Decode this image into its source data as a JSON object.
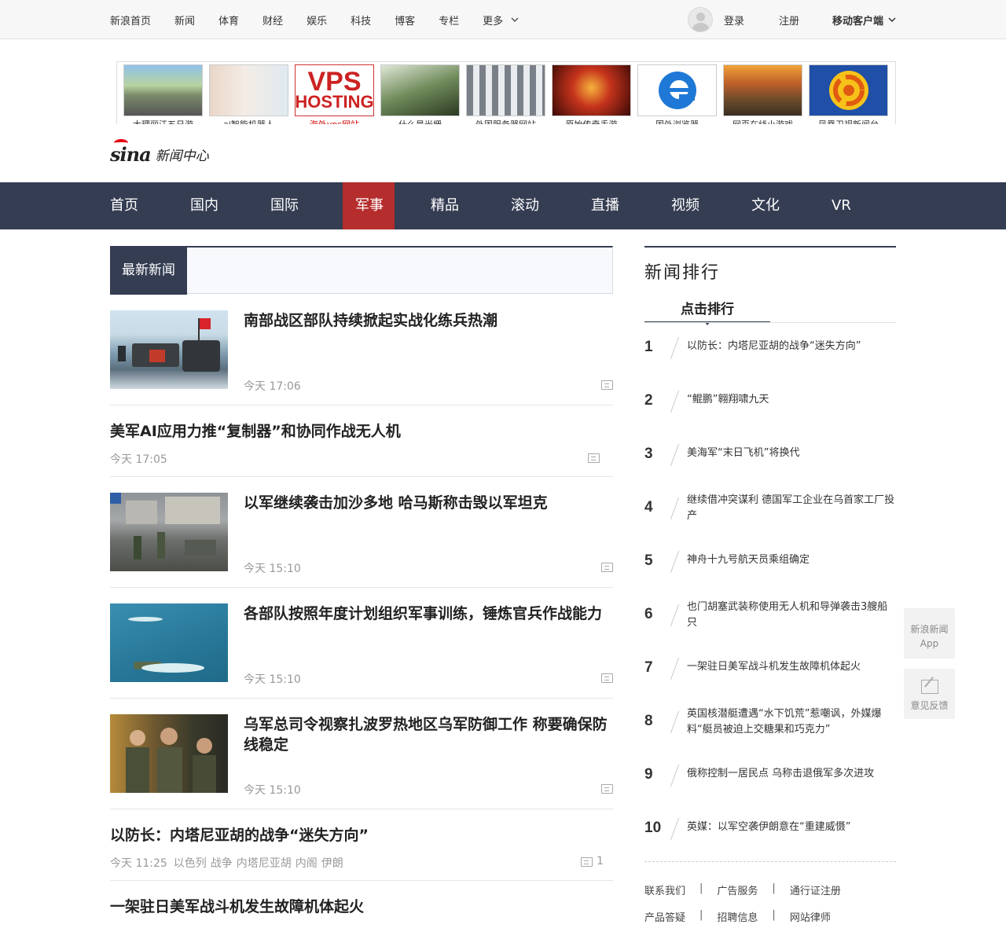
{
  "topbar": {
    "nav": [
      "新浪首页",
      "新闻",
      "体育",
      "财经",
      "娱乐",
      "科技",
      "博客",
      "专栏",
      "更多"
    ],
    "login": "登录",
    "register": "注册",
    "mobile_client": "移动客户端"
  },
  "ads": [
    {
      "caption": "大理丽江五日游",
      "red": false
    },
    {
      "caption": "ai智能机器人",
      "red": false
    },
    {
      "caption": "海外vps网站",
      "red": true
    },
    {
      "caption": "什么是光栅",
      "red": false
    },
    {
      "caption": "外国服务器网站",
      "red": false
    },
    {
      "caption": "原始传奇手游",
      "red": false
    },
    {
      "caption": "国外浏览器",
      "red": false
    },
    {
      "caption": "网页在线小游戏",
      "red": false
    },
    {
      "caption": "凤凰卫视新闻台",
      "red": false
    }
  ],
  "logo": {
    "brand": "sina",
    "section": "新闻中心"
  },
  "mainnav": [
    "首页",
    "国内",
    "国际",
    "军事",
    "精品",
    "滚动",
    "直播",
    "视频",
    "文化",
    "VR"
  ],
  "mainnav_active": "军事",
  "latest_label": "最新新闻",
  "news": [
    {
      "title": "南部战区部队持续掀起实战化练兵热潮",
      "time": "今天 17:06",
      "has_thumb": true
    },
    {
      "title": "美军AI应用力推“复制器”和协同作战无人机",
      "time": "今天 17:05",
      "has_thumb": false
    },
    {
      "title": "以军继续袭击加沙多地 哈马斯称击毁以军坦克",
      "time": "今天 15:10",
      "has_thumb": true
    },
    {
      "title": "各部队按照年度计划组织军事训练，锤炼官兵作战能力",
      "time": "今天 15:10",
      "has_thumb": true
    },
    {
      "title": "乌军总司令视察扎波罗热地区乌军防御工作 称要确保防线稳定",
      "time": "今天 15:10",
      "has_thumb": true
    },
    {
      "title": "以防长：内塔尼亚胡的战争“迷失方向”",
      "time": "今天 11:25",
      "tags": [
        "以色列",
        "战争",
        "内塔尼亚胡",
        "内阁",
        "伊朗"
      ],
      "comments": "1",
      "has_thumb": false
    },
    {
      "title": "一架驻日美军战斗机发生故障机体起火",
      "time": "",
      "has_thumb": false
    }
  ],
  "ranking": {
    "title": "新闻排行",
    "tab": "点击排行",
    "items": [
      {
        "num": "1",
        "text": "以防长：内塔尼亚胡的战争“迷失方向”"
      },
      {
        "num": "2",
        "text": "“鲲鹏”翱翔啸九天"
      },
      {
        "num": "3",
        "text": "美海军“末日飞机”将换代"
      },
      {
        "num": "4",
        "text": "继续借冲突谋利 德国军工企业在乌首家工厂投产"
      },
      {
        "num": "5",
        "text": "神舟十九号航天员乘组确定"
      },
      {
        "num": "6",
        "text": "也门胡塞武装称使用无人机和导弹袭击3艘船只"
      },
      {
        "num": "7",
        "text": "一架驻日美军战斗机发生故障机体起火"
      },
      {
        "num": "8",
        "text": "英国核潜艇遭遇“水下饥荒”惹嘲讽，外媒爆料“艇员被迫上交糖果和巧克力”"
      },
      {
        "num": "9",
        "text": "俄称控制一居民点 乌称击退俄军多次进攻"
      },
      {
        "num": "10",
        "text": "英媒：以军空袭伊朗意在“重建威慑”"
      }
    ]
  },
  "footer": {
    "row1": [
      "联系我们",
      "广告服务",
      "通行证注册"
    ],
    "row2": [
      "产品答疑",
      "招聘信息",
      "网站律师"
    ]
  },
  "float": {
    "app_label1": "新浪新闻",
    "app_label2": "App",
    "feedback": "意见反馈"
  }
}
